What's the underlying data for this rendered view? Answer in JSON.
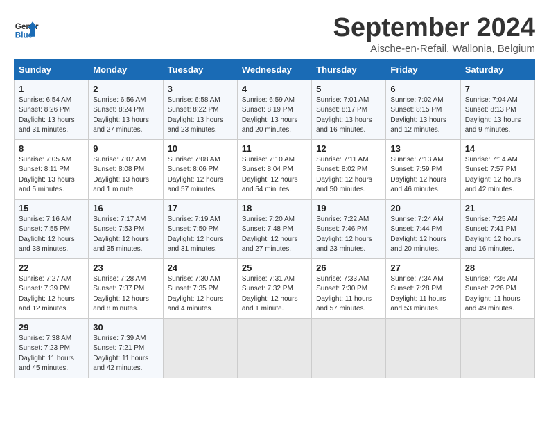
{
  "header": {
    "logo_line1": "General",
    "logo_line2": "Blue",
    "month_title": "September 2024",
    "location": "Aische-en-Refail, Wallonia, Belgium"
  },
  "days_of_week": [
    "Sunday",
    "Monday",
    "Tuesday",
    "Wednesday",
    "Thursday",
    "Friday",
    "Saturday"
  ],
  "weeks": [
    [
      {
        "day": "1",
        "info": "Sunrise: 6:54 AM\nSunset: 8:26 PM\nDaylight: 13 hours and 31 minutes."
      },
      {
        "day": "2",
        "info": "Sunrise: 6:56 AM\nSunset: 8:24 PM\nDaylight: 13 hours and 27 minutes."
      },
      {
        "day": "3",
        "info": "Sunrise: 6:58 AM\nSunset: 8:22 PM\nDaylight: 13 hours and 23 minutes."
      },
      {
        "day": "4",
        "info": "Sunrise: 6:59 AM\nSunset: 8:19 PM\nDaylight: 13 hours and 20 minutes."
      },
      {
        "day": "5",
        "info": "Sunrise: 7:01 AM\nSunset: 8:17 PM\nDaylight: 13 hours and 16 minutes."
      },
      {
        "day": "6",
        "info": "Sunrise: 7:02 AM\nSunset: 8:15 PM\nDaylight: 13 hours and 12 minutes."
      },
      {
        "day": "7",
        "info": "Sunrise: 7:04 AM\nSunset: 8:13 PM\nDaylight: 13 hours and 9 minutes."
      }
    ],
    [
      {
        "day": "8",
        "info": "Sunrise: 7:05 AM\nSunset: 8:11 PM\nDaylight: 13 hours and 5 minutes."
      },
      {
        "day": "9",
        "info": "Sunrise: 7:07 AM\nSunset: 8:08 PM\nDaylight: 13 hours and 1 minute."
      },
      {
        "day": "10",
        "info": "Sunrise: 7:08 AM\nSunset: 8:06 PM\nDaylight: 12 hours and 57 minutes."
      },
      {
        "day": "11",
        "info": "Sunrise: 7:10 AM\nSunset: 8:04 PM\nDaylight: 12 hours and 54 minutes."
      },
      {
        "day": "12",
        "info": "Sunrise: 7:11 AM\nSunset: 8:02 PM\nDaylight: 12 hours and 50 minutes."
      },
      {
        "day": "13",
        "info": "Sunrise: 7:13 AM\nSunset: 7:59 PM\nDaylight: 12 hours and 46 minutes."
      },
      {
        "day": "14",
        "info": "Sunrise: 7:14 AM\nSunset: 7:57 PM\nDaylight: 12 hours and 42 minutes."
      }
    ],
    [
      {
        "day": "15",
        "info": "Sunrise: 7:16 AM\nSunset: 7:55 PM\nDaylight: 12 hours and 38 minutes."
      },
      {
        "day": "16",
        "info": "Sunrise: 7:17 AM\nSunset: 7:53 PM\nDaylight: 12 hours and 35 minutes."
      },
      {
        "day": "17",
        "info": "Sunrise: 7:19 AM\nSunset: 7:50 PM\nDaylight: 12 hours and 31 minutes."
      },
      {
        "day": "18",
        "info": "Sunrise: 7:20 AM\nSunset: 7:48 PM\nDaylight: 12 hours and 27 minutes."
      },
      {
        "day": "19",
        "info": "Sunrise: 7:22 AM\nSunset: 7:46 PM\nDaylight: 12 hours and 23 minutes."
      },
      {
        "day": "20",
        "info": "Sunrise: 7:24 AM\nSunset: 7:44 PM\nDaylight: 12 hours and 20 minutes."
      },
      {
        "day": "21",
        "info": "Sunrise: 7:25 AM\nSunset: 7:41 PM\nDaylight: 12 hours and 16 minutes."
      }
    ],
    [
      {
        "day": "22",
        "info": "Sunrise: 7:27 AM\nSunset: 7:39 PM\nDaylight: 12 hours and 12 minutes."
      },
      {
        "day": "23",
        "info": "Sunrise: 7:28 AM\nSunset: 7:37 PM\nDaylight: 12 hours and 8 minutes."
      },
      {
        "day": "24",
        "info": "Sunrise: 7:30 AM\nSunset: 7:35 PM\nDaylight: 12 hours and 4 minutes."
      },
      {
        "day": "25",
        "info": "Sunrise: 7:31 AM\nSunset: 7:32 PM\nDaylight: 12 hours and 1 minute."
      },
      {
        "day": "26",
        "info": "Sunrise: 7:33 AM\nSunset: 7:30 PM\nDaylight: 11 hours and 57 minutes."
      },
      {
        "day": "27",
        "info": "Sunrise: 7:34 AM\nSunset: 7:28 PM\nDaylight: 11 hours and 53 minutes."
      },
      {
        "day": "28",
        "info": "Sunrise: 7:36 AM\nSunset: 7:26 PM\nDaylight: 11 hours and 49 minutes."
      }
    ],
    [
      {
        "day": "29",
        "info": "Sunrise: 7:38 AM\nSunset: 7:23 PM\nDaylight: 11 hours and 45 minutes."
      },
      {
        "day": "30",
        "info": "Sunrise: 7:39 AM\nSunset: 7:21 PM\nDaylight: 11 hours and 42 minutes."
      },
      {
        "day": "",
        "info": ""
      },
      {
        "day": "",
        "info": ""
      },
      {
        "day": "",
        "info": ""
      },
      {
        "day": "",
        "info": ""
      },
      {
        "day": "",
        "info": ""
      }
    ]
  ]
}
